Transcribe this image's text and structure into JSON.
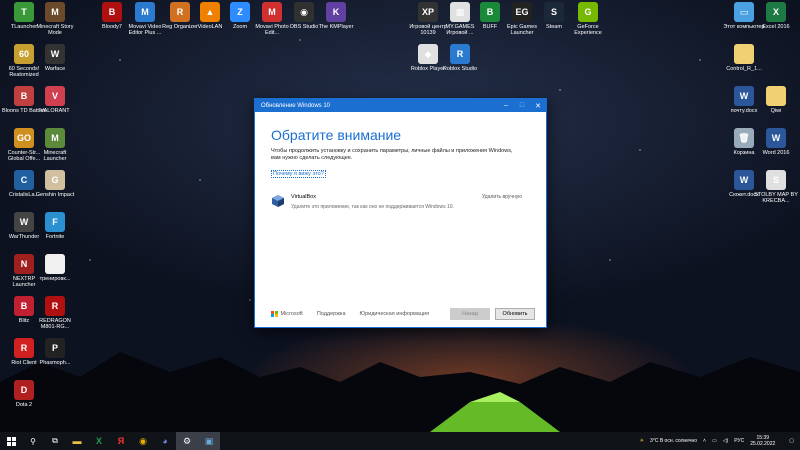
{
  "desktop_left": [
    {
      "label": "TLauncher",
      "color": "#3a9a3a",
      "glyph": "T"
    },
    {
      "label": "Minecraft Story Mode",
      "color": "#6b4a2a",
      "glyph": "M"
    },
    {
      "label": "60 Seconds! Reatomized",
      "color": "#c8a030",
      "glyph": "60"
    },
    {
      "label": "Warface",
      "color": "#333",
      "glyph": "W"
    },
    {
      "label": "Bloons TD Battles",
      "color": "#c04040",
      "glyph": "B"
    },
    {
      "label": "VALORANT",
      "color": "#d04050",
      "glyph": "V"
    },
    {
      "label": "Counter-Str... Global Offe...",
      "color": "#d09020",
      "glyph": "GO"
    },
    {
      "label": "Minecraft Launcher",
      "color": "#5a8a3a",
      "glyph": "M"
    },
    {
      "label": "CristalixLa...",
      "color": "#2060a0",
      "glyph": "C"
    },
    {
      "label": "Genshin Impact",
      "color": "#d0c0a0",
      "glyph": "G"
    },
    {
      "label": "WarThunder",
      "color": "#444",
      "glyph": "W"
    },
    {
      "label": "Fortnite",
      "color": "#2a90d0",
      "glyph": "F"
    },
    {
      "label": "NEXTRP Launcher",
      "color": "#a02020",
      "glyph": "N"
    },
    {
      "label": "тренировк...",
      "color": "#f0f0f0",
      "glyph": ""
    },
    {
      "label": "Blitz",
      "color": "#c02030",
      "glyph": "B"
    },
    {
      "label": "REDRAGON M801-RG...",
      "color": "#b01010",
      "glyph": "R"
    },
    {
      "label": "Riot Client",
      "color": "#d02020",
      "glyph": "R"
    },
    {
      "label": "Phasmoph...",
      "color": "#222",
      "glyph": "P"
    },
    {
      "label": "Dota 2",
      "color": "#b02020",
      "glyph": "D"
    }
  ],
  "desktop_top": [
    {
      "label": "Bloody7",
      "color": "#b01010",
      "glyph": "B"
    },
    {
      "label": "Movavi Video Editor Plus ...",
      "color": "#2a7ad0",
      "glyph": "M"
    },
    {
      "label": "Reg Organizer",
      "color": "#d07020",
      "glyph": "R"
    },
    {
      "label": "VideoLAN",
      "color": "#f08000",
      "glyph": "▲"
    },
    {
      "label": "Zoom",
      "color": "#2d8cff",
      "glyph": "Z"
    },
    {
      "label": "Movavi Photo Edit...",
      "color": "#d03030",
      "glyph": "M"
    },
    {
      "label": "OBS Studio",
      "color": "#303030",
      "glyph": "◉"
    },
    {
      "label": "The KMPlayer",
      "color": "#6040a0",
      "glyph": "K"
    },
    {
      "label": "Игровой центр 10139",
      "color": "#333",
      "glyph": "XP"
    },
    {
      "label": "MY.GAMES Игровой ...",
      "color": "#e0e0e0",
      "glyph": "▦"
    },
    {
      "label": "BUFF",
      "color": "#1a8a3a",
      "glyph": "B"
    },
    {
      "label": "Epic Games Launcher",
      "color": "#222",
      "glyph": "EG"
    },
    {
      "label": "Steam",
      "color": "#1b2838",
      "glyph": "S"
    },
    {
      "label": "GeForce Experience",
      "color": "#76b900",
      "glyph": "G"
    },
    {
      "label": "Roblox Player",
      "color": "#e0e0e0",
      "glyph": "◆"
    },
    {
      "label": "Roblox Studio",
      "color": "#2a7ad0",
      "glyph": "R"
    }
  ],
  "desktop_right": [
    {
      "label": "Этот компьютер",
      "color": "#4aa0e0",
      "glyph": "▭"
    },
    {
      "label": "Excel 2016",
      "color": "#1d7a45",
      "glyph": "X"
    },
    {
      "label": "Control_R_1...",
      "color": "#f0d070",
      "glyph": ""
    },
    {
      "label": "почту.docx",
      "color": "#2b579a",
      "glyph": "W"
    },
    {
      "label": "Qiwi",
      "color": "#f0d070",
      "glyph": ""
    },
    {
      "label": "Корзина",
      "color": "#9ab",
      "glyph": "🗑"
    },
    {
      "label": "Word 2016",
      "color": "#2b579a",
      "glyph": "W"
    },
    {
      "label": "Сюжет.docx",
      "color": "#2b579a",
      "glyph": "W"
    },
    {
      "label": "STOLBY MAP BY KRECBA...",
      "color": "#e0e0e0",
      "glyph": "S"
    }
  ],
  "window": {
    "title": "Обновление Windows 10",
    "heading": "Обратите внимание",
    "description": "Чтобы продолжить установку и сохранить параметры, личные файлы и приложения Windows, вам нужно сделать следующее.",
    "why_link": "Почему я вижу это?",
    "app_name": "VirtualBox",
    "app_note": "Удалите это приложение, так как оно не поддерживается Windows 10.",
    "app_action": "Удалить вручную",
    "ms_label": "Microsoft",
    "support_link": "Поддержка",
    "legal_link": "Юридическая информация",
    "back_button": "Назад",
    "refresh_button": "Обновить"
  },
  "tray": {
    "weather": "3°C В осн. солнечно",
    "language": "РУС",
    "time": "15:39",
    "date": "25.02.2022"
  }
}
